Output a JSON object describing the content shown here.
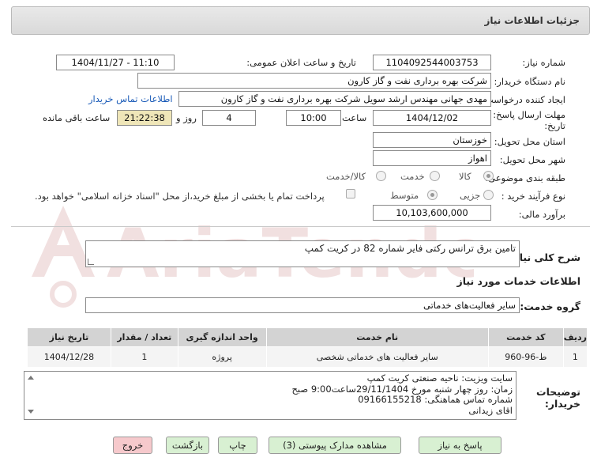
{
  "header": {
    "title": "جزئیات اطلاعات نیاز"
  },
  "fields": {
    "need_number_label": "شماره نیاز:",
    "need_number": "1104092544003753",
    "announce_label": "تاریخ و ساعت اعلان عمومی:",
    "announce_value": "1404/11/27 - 11:10",
    "buyer_org_label": "نام دستگاه خریدار:",
    "buyer_org": "شرکت بهره برداری نفت و گاز کارون",
    "creator_label": "ایجاد کننده درخواست:",
    "creator": "مهدی جهانی مهندس ارشد سویل شرکت بهره برداری نفت و گاز کارون",
    "contact_link": "اطلاعات تماس خریدار",
    "deadline_label_1": "مهلت ارسال پاسخ: تا",
    "deadline_label_2": "تاریخ:",
    "deadline_date": "1404/12/02",
    "time_label": "ساعت",
    "deadline_time": "10:00",
    "days_value": "4",
    "days_label": "روز و",
    "remaining_time": "21:22:38",
    "remaining_label": "ساعت باقی مانده",
    "province_label": "استان محل تحویل:",
    "province": "خوزستان",
    "city_label": "شهر محل تحویل:",
    "city": "اهواز",
    "category_label": "طبقه بندی موضوعی:",
    "category_options": [
      "کالا",
      "خدمت",
      "کالا/خدمت"
    ],
    "purchase_type_label": "نوع فرآیند خرید :",
    "purchase_options": [
      "جزیی",
      "متوسط"
    ],
    "payment_note": "پرداخت تمام یا بخشی از مبلغ خرید،از محل \"اسناد خزانه اسلامی\" خواهد بود.",
    "estimate_label": "برآورد مالی:",
    "estimate": "10,103,600,000"
  },
  "summary": {
    "label": "شرح کلی نیاز:",
    "text": "تامین برق ترانس رکتی فایر شماره 82 در کریت کمپ"
  },
  "services": {
    "section_title": "اطلاعات خدمات مورد نیاز",
    "group_label": "گروه خدمت:",
    "group_value": "سایر فعالیت‌های خدماتی"
  },
  "table": {
    "headers": [
      "ردیف",
      "کد خدمت",
      "نام خدمت",
      "واحد اندازه گیری",
      "تعداد / مقدار",
      "تاریخ نیاز"
    ],
    "rows": [
      [
        "1",
        "ط-96-960",
        "سایر فعالیت های خدماتی شخصی",
        "پروژه",
        "1",
        "1404/12/28"
      ]
    ]
  },
  "notes": {
    "label_1": "توضیحات",
    "label_2": "خریدار:",
    "lines": [
      "سایت ویزیت: ناحیه صنعتی کریت کمپ",
      "زمان: روز چهار شنبه مورخ 29/11/1404ساعت9:00 صبح",
      "شماره تماس هماهنگی: 09166155218",
      "اقای زیدانی"
    ]
  },
  "buttons": {
    "reply": "پاسخ به نیاز",
    "attachments": "مشاهده مدارک پیوستی (3)",
    "print": "چاپ",
    "back": "بازگشت",
    "exit": "خروج"
  },
  "colors": {
    "link": "#1a5bb8",
    "reply_bg": "#d8f0d2",
    "exit_bg": "#f6c9cc",
    "remaining_bg": "#efe6b8"
  }
}
